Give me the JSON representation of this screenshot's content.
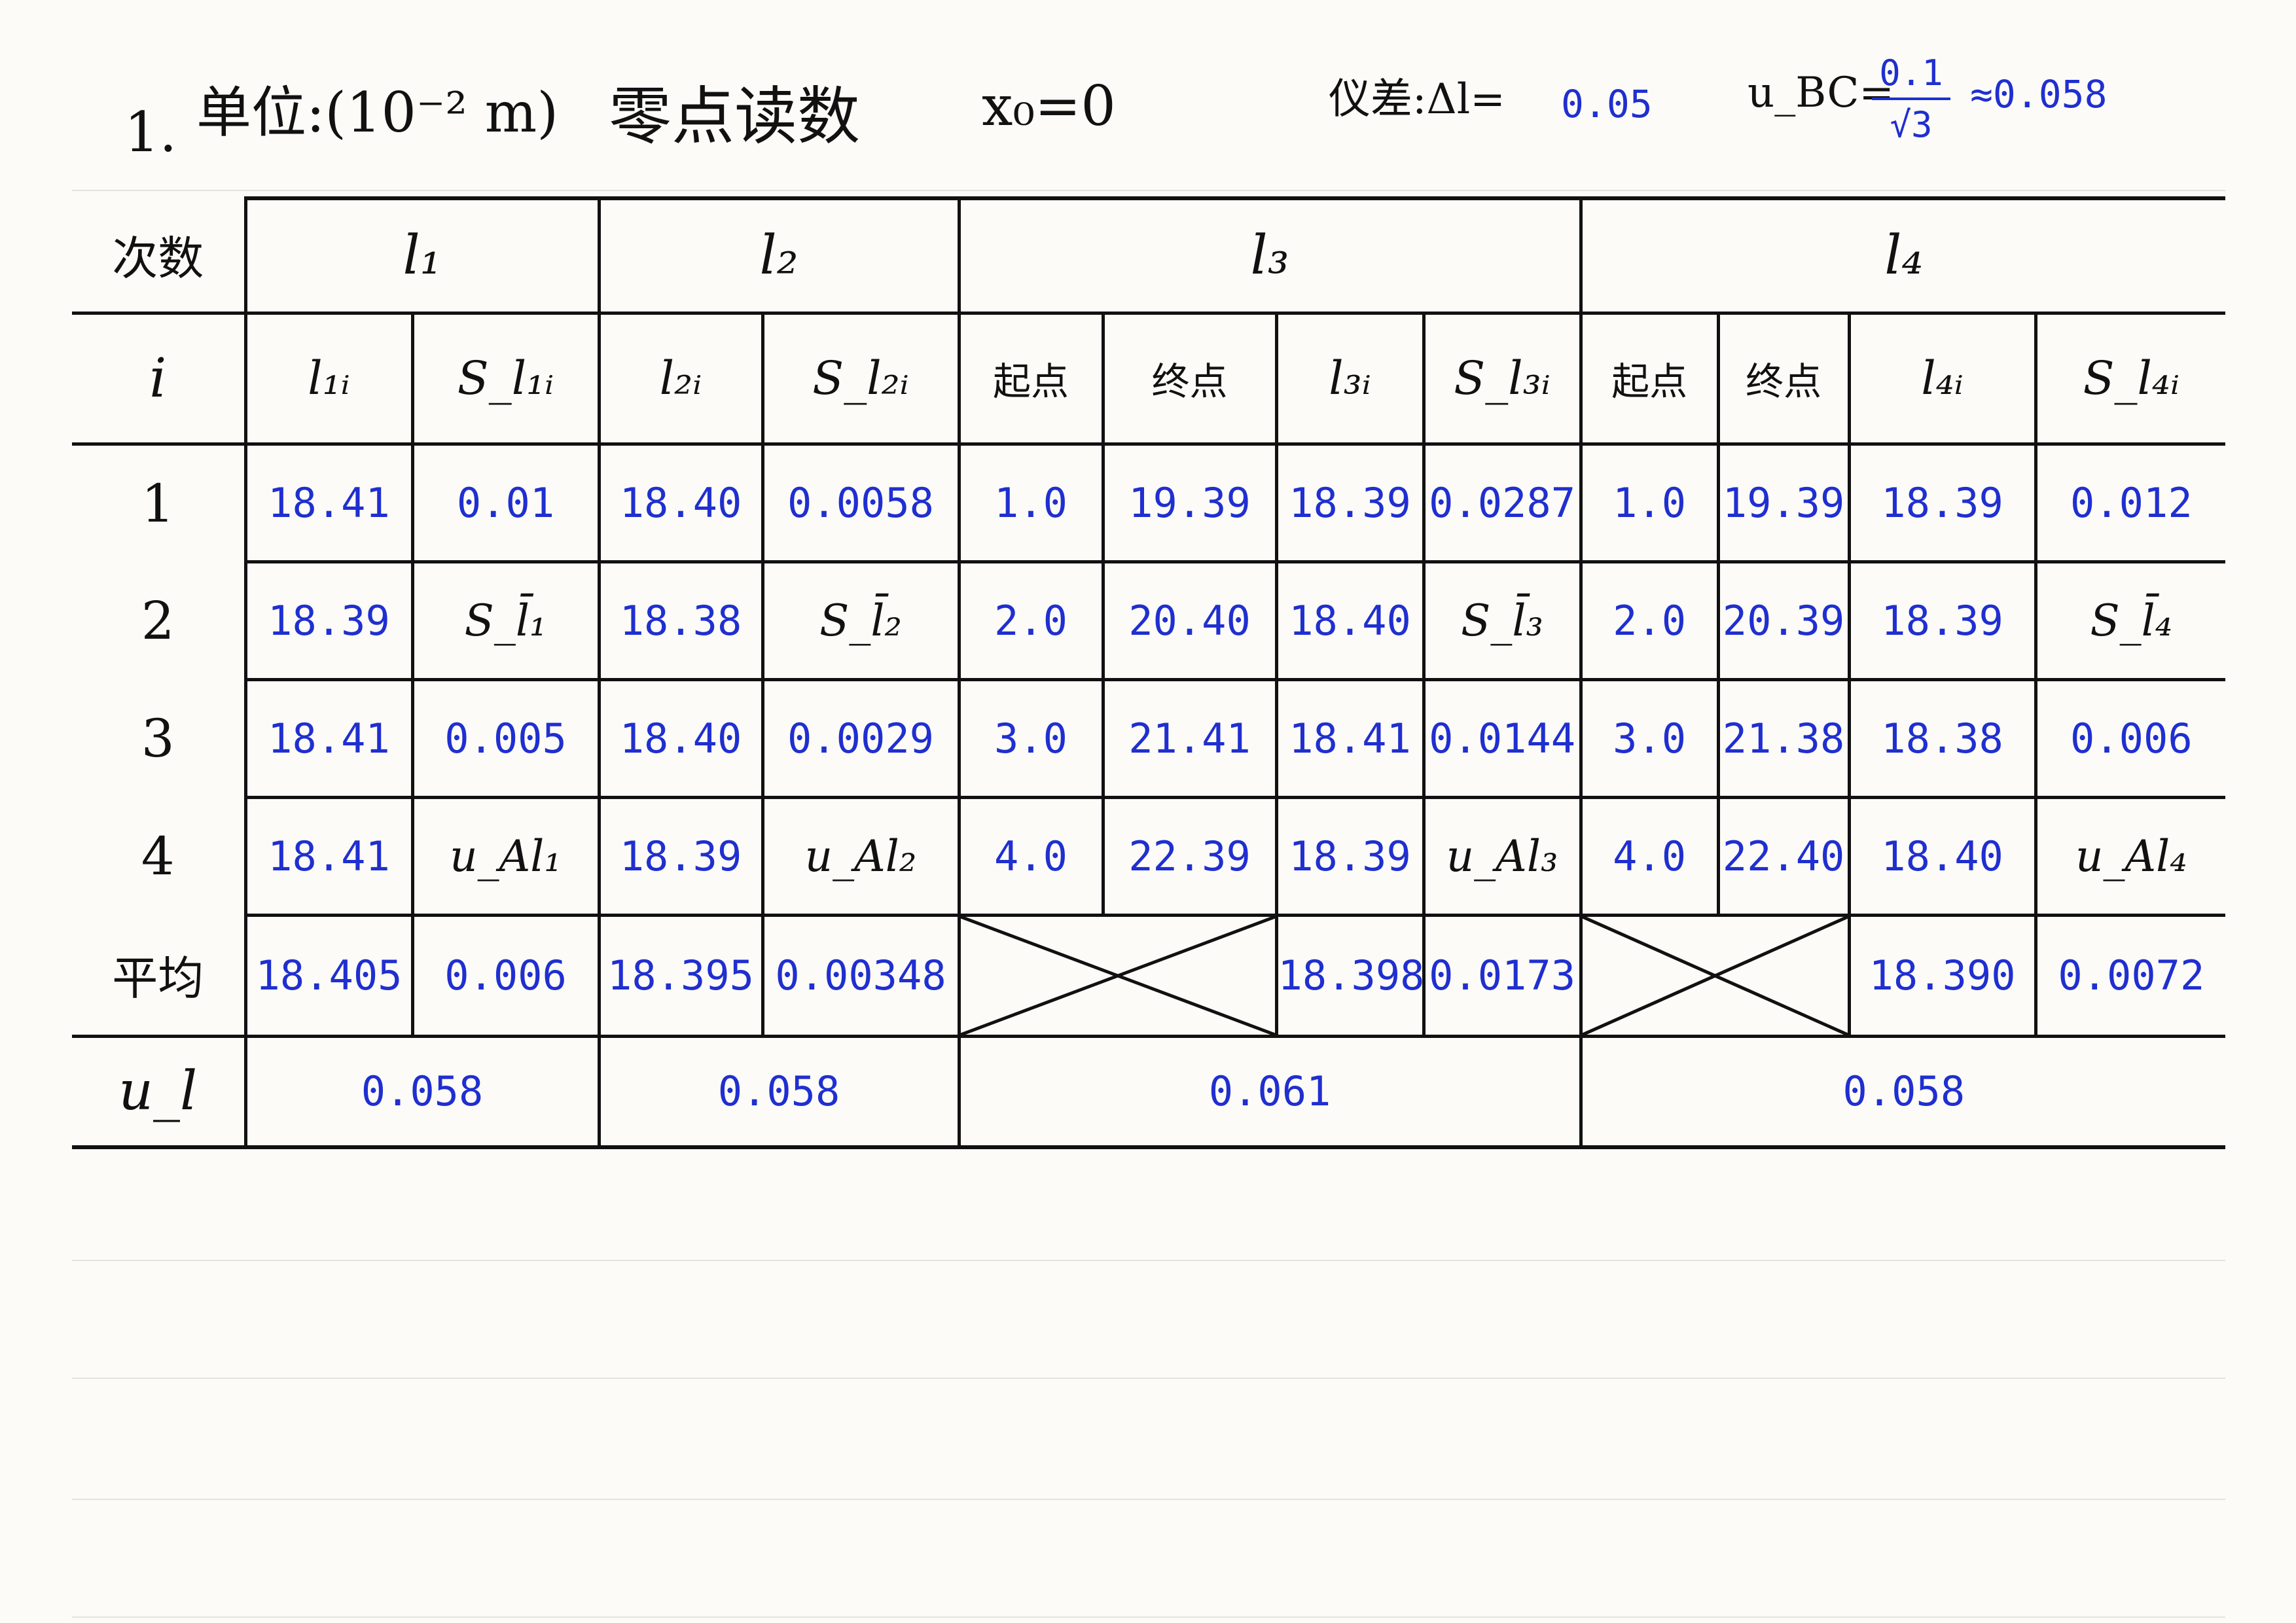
{
  "header": {
    "item_no": "1.",
    "unit": "单位:(10⁻² m)",
    "zero_label": "零点读数",
    "zero_value": "x₀=0",
    "error_label": "仪差:Δl=",
    "error_value": "0.05",
    "ubc_label": "u_BC=",
    "ubc_num": "0.1",
    "ubc_den": "√3",
    "ubc_approx": "≈0.058"
  },
  "table": {
    "corner_top": "次数",
    "corner_bottom": "i",
    "groups": [
      "l₁",
      "l₂",
      "l₃",
      "l₄"
    ],
    "subheaders": [
      "l₁ᵢ",
      "S_l₁ᵢ",
      "l₂ᵢ",
      "S_l₂ᵢ",
      "起点",
      "终点",
      "l₃ᵢ",
      "S_l₃ᵢ",
      "起点",
      "终点",
      "l₄ᵢ",
      "S_l₄ᵢ"
    ],
    "rows": [
      {
        "i": "1",
        "cells": [
          "18.41",
          "0.01",
          "18.40",
          "0.0058",
          "1.0",
          "19.39",
          "18.39",
          "0.0287",
          "1.0",
          "19.39",
          "18.39",
          "0.012"
        ]
      },
      {
        "i": "2",
        "cells": [
          "18.39",
          "S_l̄₁",
          "18.38",
          "S_l̄₂",
          "2.0",
          "20.40",
          "18.40",
          "S_l̄₃",
          "2.0",
          "20.39",
          "18.39",
          "S_l̄₄"
        ]
      },
      {
        "i": "3",
        "cells": [
          "18.41",
          "0.005",
          "18.40",
          "0.0029",
          "3.0",
          "21.41",
          "18.41",
          "0.0144",
          "3.0",
          "21.38",
          "18.38",
          "0.006"
        ]
      },
      {
        "i": "4",
        "cells": [
          "18.41",
          "u_Al₁",
          "18.39",
          "u_Al₂",
          "4.0",
          "22.39",
          "18.39",
          "u_Al₃",
          "4.0",
          "22.40",
          "18.40",
          "u_Al₄"
        ]
      }
    ],
    "average": {
      "label": "平均",
      "l1": "18.405",
      "s1": "0.006",
      "l2": "18.395",
      "s2": "0.00348",
      "l3": "18.398",
      "s3": "0.0173",
      "l4": "18.390",
      "s4": "0.0072"
    },
    "uncertainty": {
      "label": "u_l",
      "l1": "0.058",
      "l2": "0.058",
      "l3": "0.061",
      "l4": "0.058"
    }
  }
}
